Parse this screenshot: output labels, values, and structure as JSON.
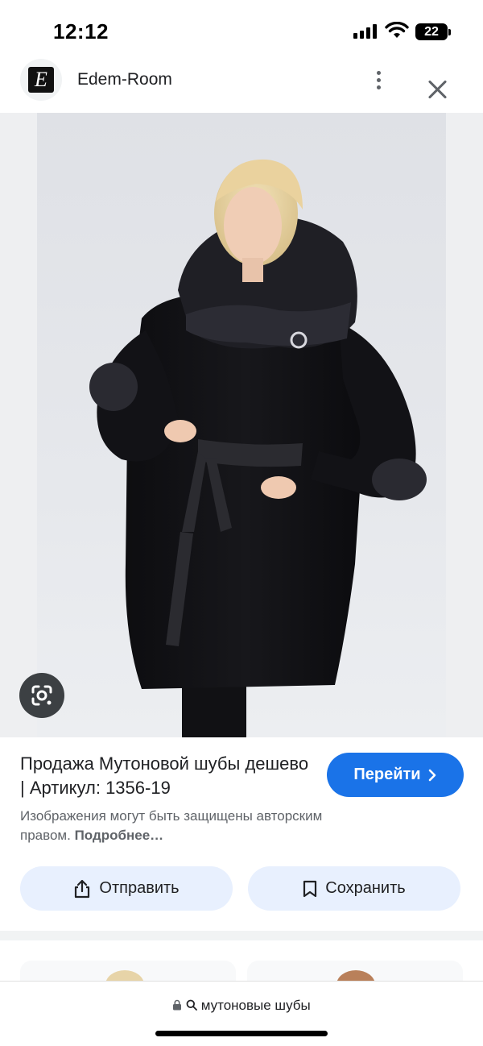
{
  "status_bar": {
    "time": "12:12",
    "battery": "22"
  },
  "header": {
    "site_name": "Edem-Room",
    "logo_letter": "E"
  },
  "icons": {
    "more": "more-vert-icon",
    "close": "close-icon",
    "lens": "google-lens-icon",
    "share": "share-icon",
    "save": "bookmark-icon",
    "lock": "lock-icon",
    "search": "search-icon",
    "chevron": "chevron-right-icon"
  },
  "result": {
    "title": "Продажа Мутоновой шубы дешево | Артикул: 1356-19",
    "goto_label": "Перейти",
    "copyright_text": "Изображения могут быть защищены авторским правом.",
    "more_link": "Подробнее…"
  },
  "actions": {
    "share_label": "Отправить",
    "save_label": "Сохранить"
  },
  "bottom_bar": {
    "query": "мутоновые шубы"
  },
  "colors": {
    "accent": "#1a73e8",
    "chip_bg": "#e8f0fe",
    "lens_bg": "#3c4043"
  }
}
